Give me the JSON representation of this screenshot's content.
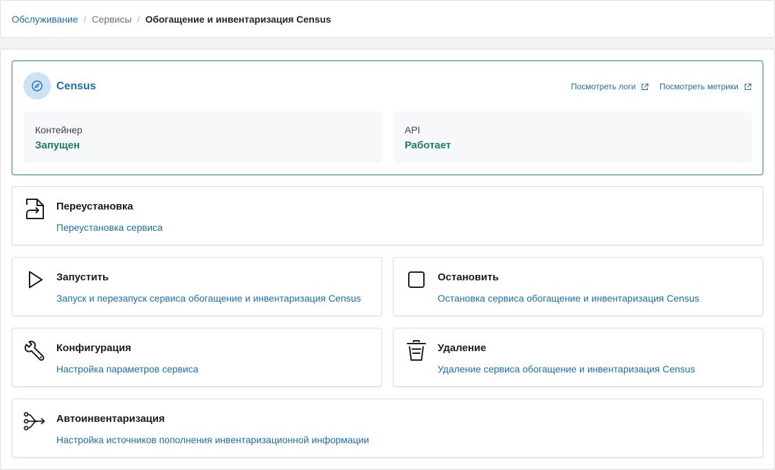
{
  "breadcrumb": {
    "items": [
      "Обслуживание",
      "Сервисы",
      "Обогащение и инвентаризация Census"
    ],
    "separator": "/"
  },
  "service": {
    "name": "Census",
    "icon": "compass-icon",
    "links": {
      "logs": "Посмотреть логи",
      "metrics": "Посмотреть метрики"
    },
    "stats": [
      {
        "label": "Контейнер",
        "value": "Запущен"
      },
      {
        "label": "API",
        "value": "Работает"
      }
    ]
  },
  "actions": {
    "reinstall": {
      "title": "Переустановка",
      "desc": "Переустановка сервиса",
      "icon": "file-reinstall-icon"
    },
    "start": {
      "title": "Запустить",
      "desc": "Запуск и перезапуск сервиса обогащение и инвентаризация Census",
      "icon": "play-icon"
    },
    "stop": {
      "title": "Остановить",
      "desc": "Остановка сервиса обогащение и инвентаризация Census",
      "icon": "stop-icon"
    },
    "config": {
      "title": "Конфигурация",
      "desc": "Настройка параметров сервиса",
      "icon": "wrench-icon"
    },
    "delete": {
      "title": "Удаление",
      "desc": "Удаление сервиса обогащение и инвентаризация Census",
      "icon": "trash-icon"
    },
    "autoinventory": {
      "title": "Автоинвентаризация",
      "desc": "Настройка источников пополнения инвентаризационной информации",
      "icon": "merge-arrows-icon"
    }
  },
  "colors": {
    "link": "#1a6fa8",
    "status_ok": "#1f7a64",
    "card_border_active": "#2c8779",
    "avatar_bg": "#cfe2f4"
  }
}
